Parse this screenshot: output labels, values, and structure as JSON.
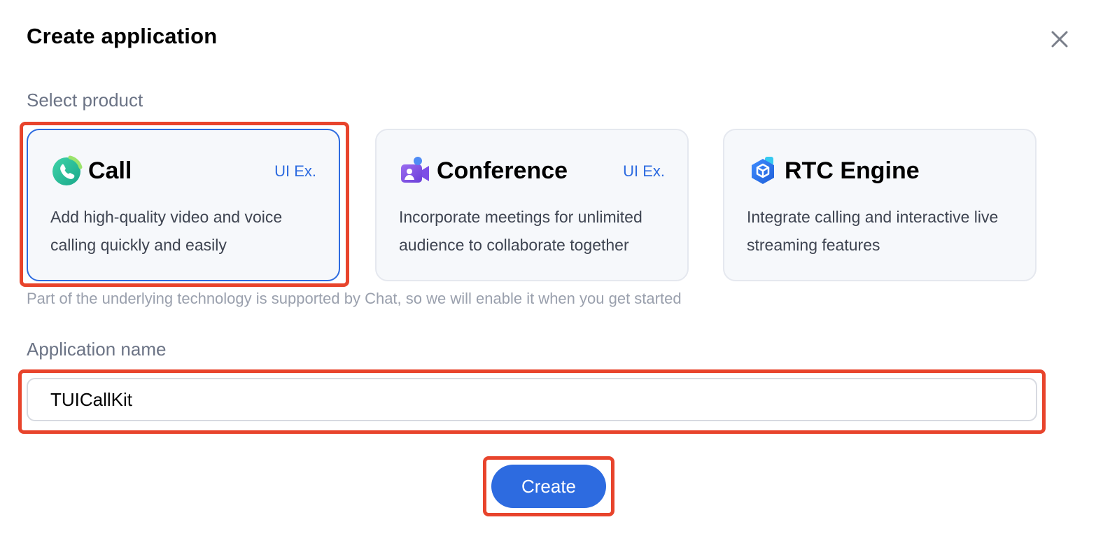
{
  "dialog": {
    "title": "Create application",
    "close_icon": "close-icon"
  },
  "product_section": {
    "label": "Select product",
    "hint": "Part of the underlying technology is supported by Chat, so we will enable it when you get started",
    "selected": "Call",
    "cards": [
      {
        "name": "Call",
        "tag": "UI Ex.",
        "description": "Add high-quality video and voice calling quickly and easily",
        "icon": "phone-call-icon",
        "selected": true
      },
      {
        "name": "Conference",
        "tag": "UI Ex.",
        "description": "Incorporate meetings for unlimited audience to collaborate together",
        "icon": "video-conference-icon",
        "selected": false
      },
      {
        "name": "RTC Engine",
        "tag": "",
        "description": "Integrate calling and interactive live streaming features",
        "icon": "rtc-cube-icon",
        "selected": false
      }
    ]
  },
  "name_section": {
    "label": "Application name",
    "value": "TUICallKit"
  },
  "actions": {
    "create_label": "Create"
  },
  "colors": {
    "accent": "#2d6be0",
    "highlight_annotation": "#e8442c",
    "card_background": "#f6f8fb",
    "muted_text": "#6b7385"
  }
}
